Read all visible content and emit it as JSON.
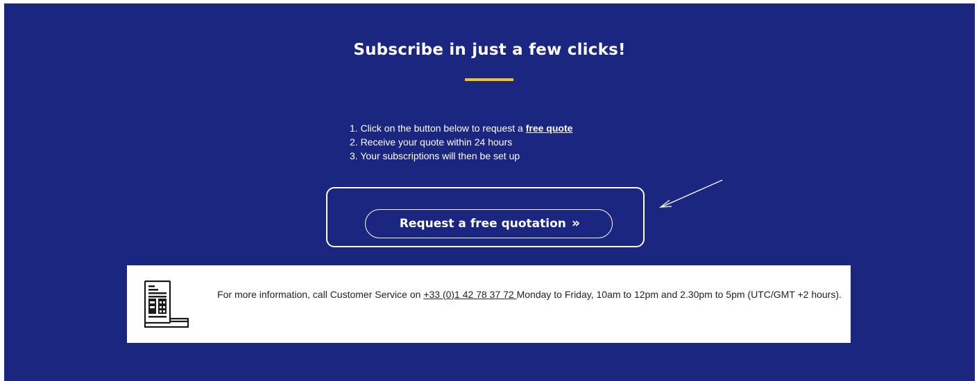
{
  "section": {
    "title": "Subscribe in just a few clicks!",
    "colors": {
      "background": "#1a2680",
      "accent": "#f5c518",
      "text": "#ffffff"
    }
  },
  "steps": {
    "step1_prefix": "1. Click on the button below to request a ",
    "step1_link": "free quote",
    "step2": "2. Receive your quote within 24 hours",
    "step3": "3. Your subscriptions will then be set up"
  },
  "cta": {
    "label": "Request a free quotation",
    "chevron": "»",
    "icon": "double-chevron-right-icon"
  },
  "info": {
    "icon": "document-calculator-icon",
    "text_before": "For more information, call Customer Service on ",
    "phone": "+33 (0)1 42 78 37 72 ",
    "text_after": "Monday to Friday, 10am to 12pm and 2.30pm to 5pm (UTC/GMT +2 hours)."
  }
}
